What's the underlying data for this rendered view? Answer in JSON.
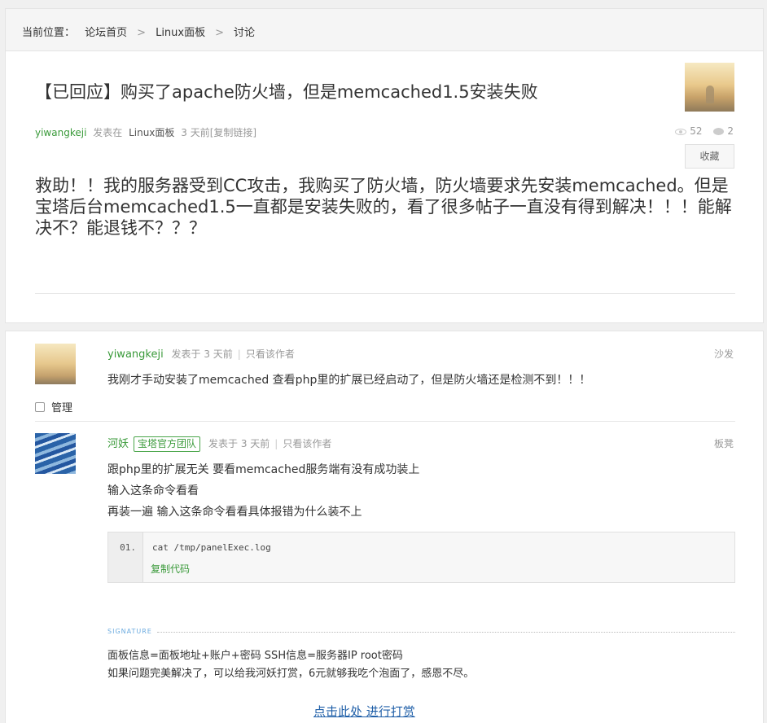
{
  "breadcrumb": {
    "prefix": "当前位置：",
    "home": "论坛首页",
    "sep": ">",
    "board": "Linux面板",
    "current": "讨论"
  },
  "thread": {
    "title": "【已回应】购买了apache防火墙，但是memcached1.5安装失败",
    "author": "yiwangkeji",
    "posted_in": "发表在",
    "board": "Linux面板",
    "time": "3 天前",
    "copy_link": "[复制链接]",
    "views": "52",
    "replies": "2",
    "favorite_label": "收藏",
    "body": "救助！！我的服务器受到CC攻击，我购买了防火墙，防火墙要求先安装memcached。但是宝塔后台memcached1.5一直都是安装失败的，看了很多帖子一直没有得到解决！！！能解决不？能退钱不？？？"
  },
  "replies": [
    {
      "user": "yiwangkeji",
      "posted": "发表于 3 天前",
      "author_only": "只看该作者",
      "floor": "沙发",
      "lines": [
        "我刚才手动安装了memcached  查看php里的扩展已经启动了，但是防火墙还是检测不到！！！"
      ],
      "manage_label": "管理"
    },
    {
      "user": "河妖",
      "badge": "宝塔官方团队",
      "posted": "发表于 3 天前",
      "author_only": "只看该作者",
      "floor": "板凳",
      "lines": [
        "跟php里的扩展无关 要看memcached服务端有没有成功装上",
        "输入这条命令看看",
        "再装一遍 输入这条命令看看具体报错为什么装不上"
      ],
      "code": {
        "line_no": "01.",
        "command": "cat /tmp/panelExec.log",
        "copy_label": "复制代码"
      },
      "signature": {
        "label": "SIGNATURE",
        "line1": "面板信息=面板地址+账户+密码 SSH信息=服务器IP root密码",
        "line2": "如果问题完美解决了，可以给我河妖打赏，6元就够我吃个泡面了，感恩不尽。"
      },
      "reward_link": "点击此处 进行打赏"
    }
  ]
}
